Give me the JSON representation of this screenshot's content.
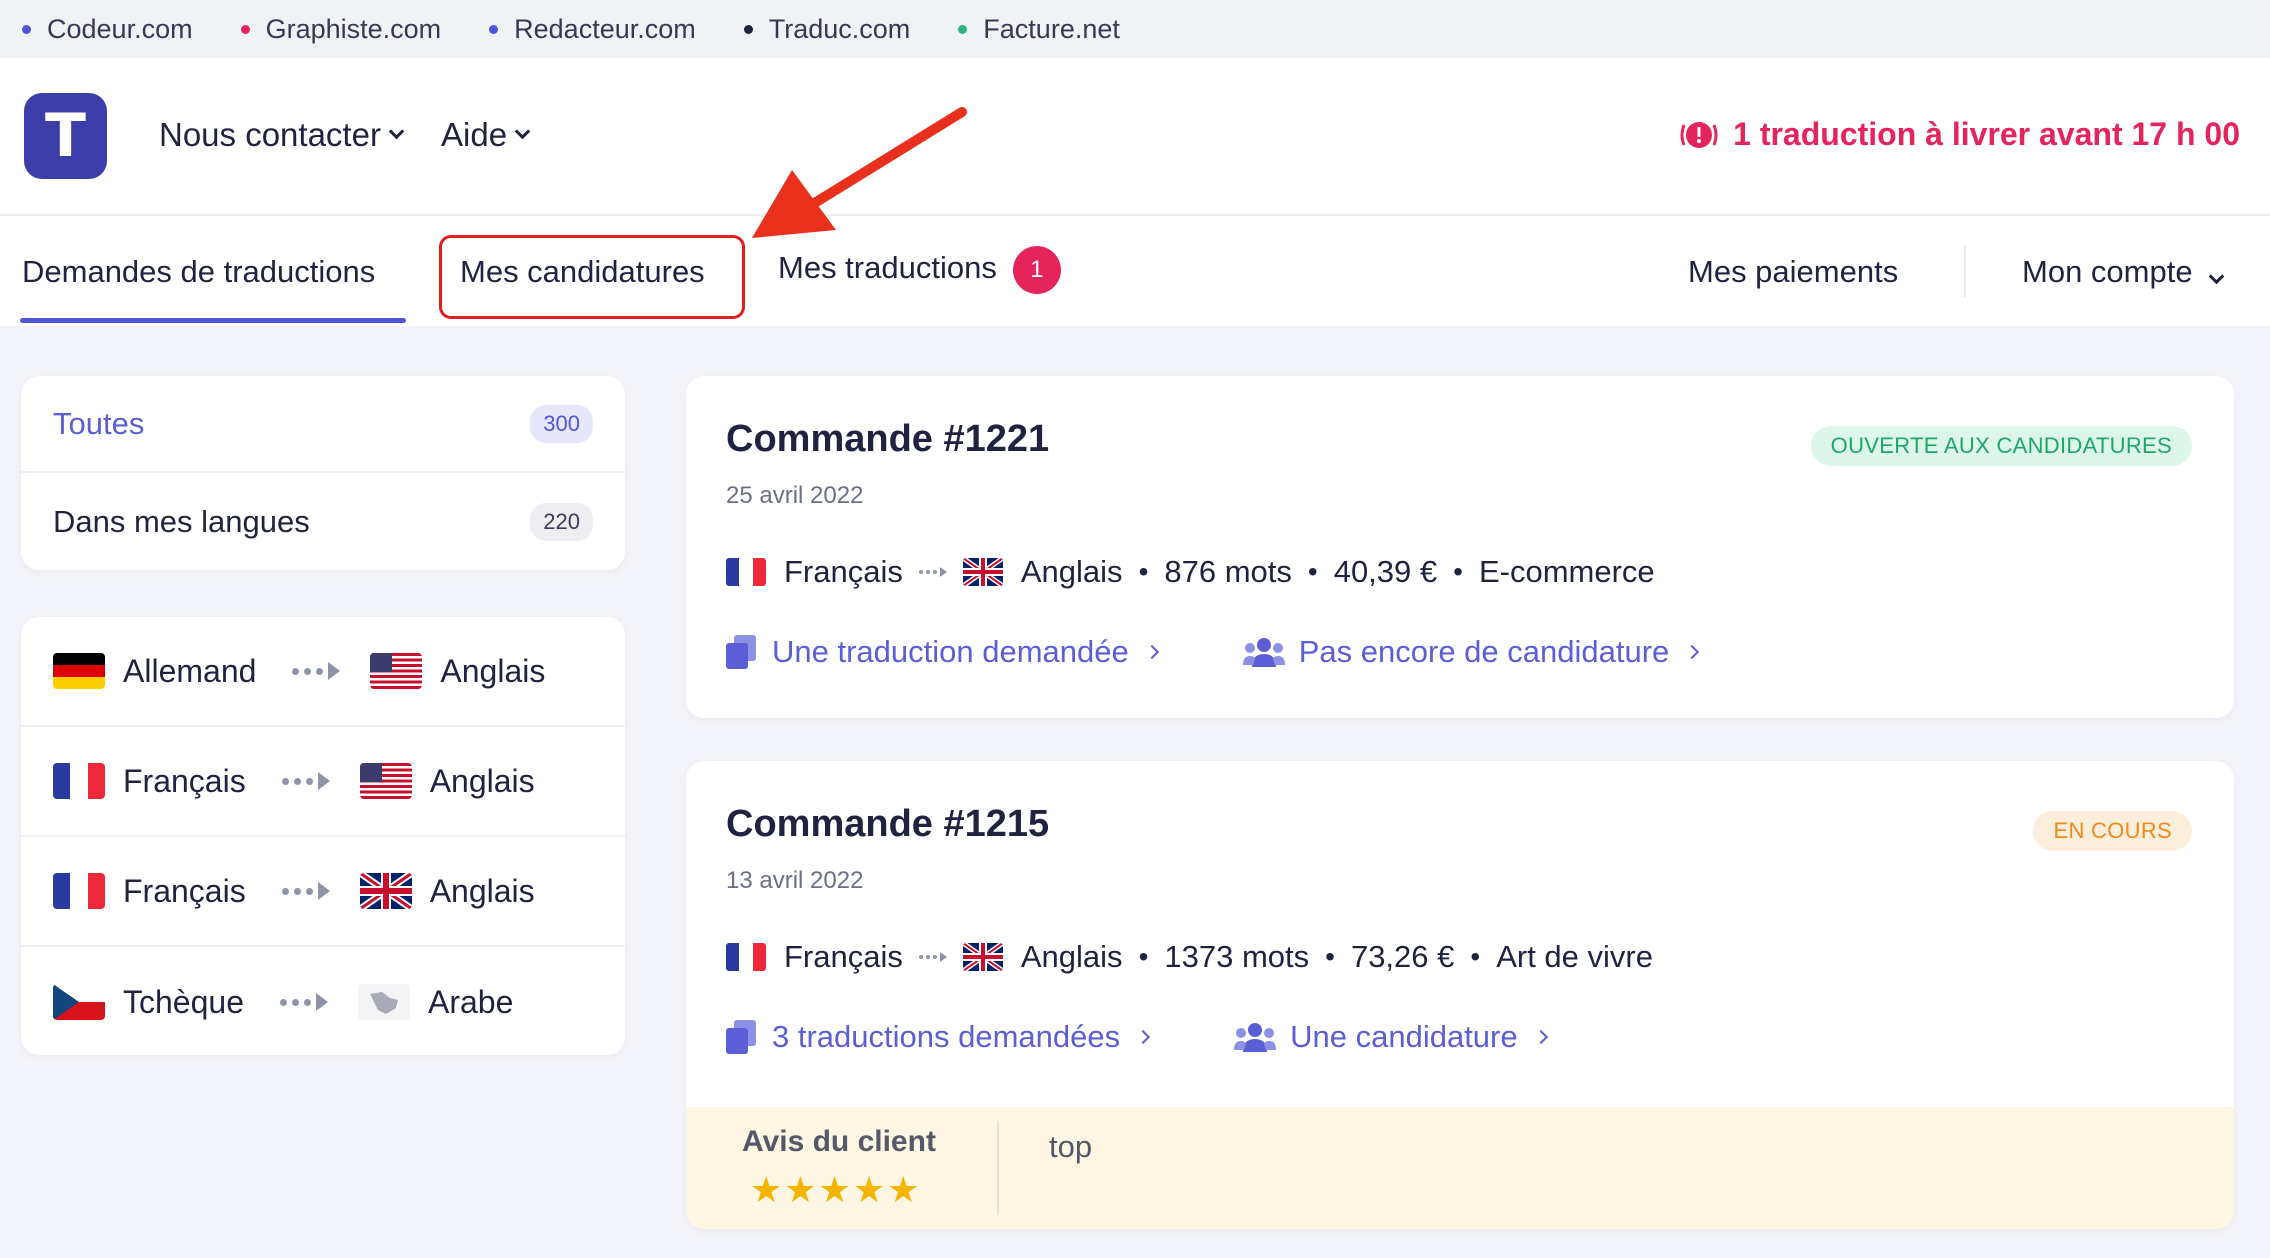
{
  "network": [
    {
      "label": "Codeur.com",
      "color": "#4f55d8"
    },
    {
      "label": "Graphiste.com",
      "color": "#e5245b"
    },
    {
      "label": "Redacteur.com",
      "color": "#4f55d8"
    },
    {
      "label": "Traduc.com",
      "color": "#1f2340"
    },
    {
      "label": "Facture.net",
      "color": "#2bb57a"
    }
  ],
  "header": {
    "logo_letter": "T",
    "nav": {
      "contact": "Nous contacter",
      "help": "Aide"
    },
    "alert": "1 traduction à livrer avant 17 h 00"
  },
  "tabs": {
    "requests": "Demandes de traductions",
    "applications": "Mes candidatures",
    "translations": "Mes traductions",
    "translations_badge": "1",
    "payments": "Mes paiements",
    "account": "Mon compte"
  },
  "filters": [
    {
      "label": "Toutes",
      "count": "300",
      "active": true
    },
    {
      "label": "Dans mes langues",
      "count": "220",
      "active": false
    }
  ],
  "pairs": [
    {
      "from": "Allemand",
      "from_flag": "de-flag-icon",
      "to": "Anglais",
      "to_flag": "us-flag-icon"
    },
    {
      "from": "Français",
      "from_flag": "fr-flag-icon",
      "to": "Anglais",
      "to_flag": "us-flag-icon"
    },
    {
      "from": "Français",
      "from_flag": "fr-flag-icon",
      "to": "Anglais",
      "to_flag": "uk-flag-icon"
    },
    {
      "from": "Tchèque",
      "from_flag": "cz-flag-icon",
      "to": "Arabe",
      "to_flag": "arab-region-icon"
    }
  ],
  "orders": [
    {
      "title": "Commande #1221",
      "date": "25 avril 2022",
      "status": "OUVERTE AUX CANDIDATURES",
      "from": "Français",
      "to": "Anglais",
      "words": "876 mots",
      "price": "40,39 €",
      "category": "E-commerce",
      "link_translations": "Une traduction demandée",
      "link_applications": "Pas encore de candidature"
    },
    {
      "title": "Commande #1215",
      "date": "13 avril 2022",
      "status": "EN COURS",
      "from": "Français",
      "to": "Anglais",
      "words": "1373 mots",
      "price": "73,26 €",
      "category": "Art de vivre",
      "link_translations": "3 traductions demandées",
      "link_applications": "Une candidature",
      "review_label": "Avis du client",
      "review_stars": 5,
      "review_text": "top"
    }
  ]
}
